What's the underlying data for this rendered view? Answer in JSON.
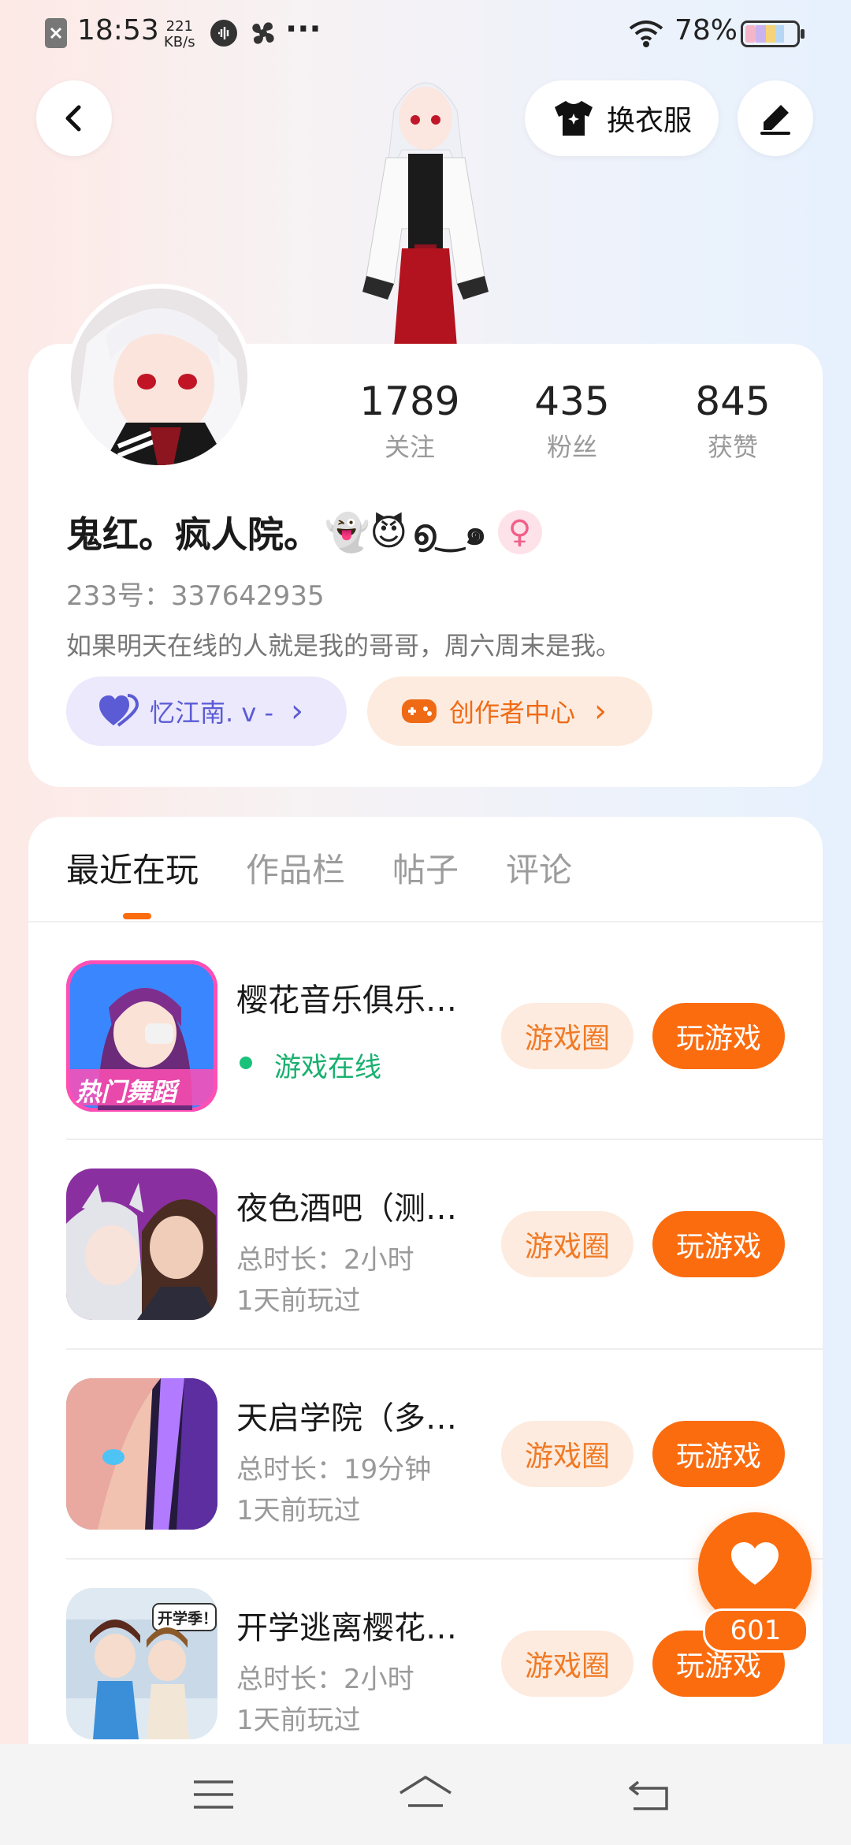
{
  "status_bar": {
    "time": "18:53",
    "net_speed_value": "221",
    "net_speed_unit": "KB/s",
    "more": "···",
    "battery": "78%"
  },
  "header": {
    "outfit_label": "换衣服"
  },
  "profile": {
    "stats": [
      {
        "value": "1789",
        "label": "关注"
      },
      {
        "value": "435",
        "label": "粉丝"
      },
      {
        "value": "845",
        "label": "获赞"
      }
    ],
    "name": "鬼红。疯人院。",
    "name_emojis": "👻😈",
    "name_kaomoji": "൭‿๑",
    "gender_symbol": "♀",
    "id_text": "233号：337642935",
    "bio": "如果明天在线的人就是我的哥哥，周六周末是我。",
    "chip_partner": "忆江南. v -",
    "chip_creator": "创作者中心",
    "chip_arrow": "›"
  },
  "tabs": [
    {
      "label": "最近在玩",
      "active": true
    },
    {
      "label": "作品栏",
      "active": false
    },
    {
      "label": "帖子",
      "active": false
    },
    {
      "label": "评论",
      "active": false
    }
  ],
  "games": [
    {
      "title": "樱花音乐俱乐…",
      "line1": "游戏在线",
      "line2": "",
      "online": true,
      "badge": "热门舞蹈"
    },
    {
      "title": "夜色酒吧（测…",
      "line1": "总时长：2小时",
      "line2": "1天前玩过",
      "online": false,
      "badge": ""
    },
    {
      "title": "天启学院（多…",
      "line1": "总时长：19分钟",
      "line2": "1天前玩过",
      "online": false,
      "badge": ""
    },
    {
      "title": "开学逃离樱花…",
      "line1": "总时长：2小时",
      "line2": "1天前玩过",
      "online": false,
      "badge": "开学季！"
    }
  ],
  "game_buttons": {
    "circle": "游戏圈",
    "play": "玩游戏"
  },
  "like_fab": {
    "count": "601"
  },
  "colors": {
    "accent_orange": "#fb6c0f",
    "light_orange": "#fdebdf",
    "purple_chip": "#ebe9fb",
    "online_green": "#19c27a"
  }
}
